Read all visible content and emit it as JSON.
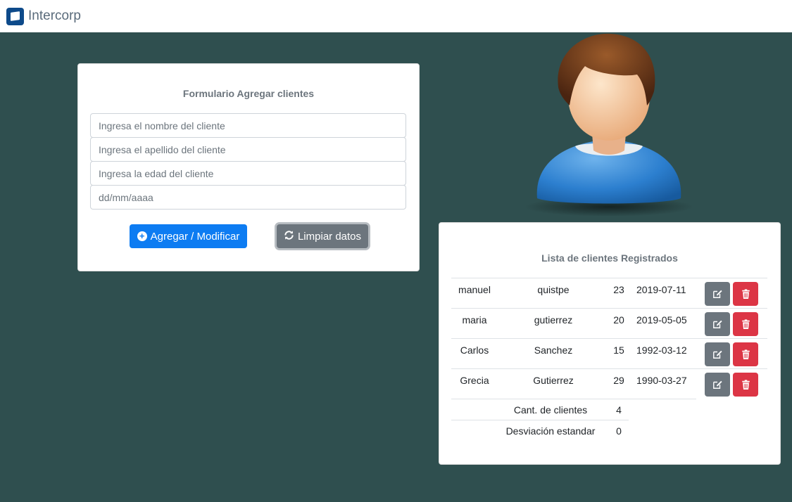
{
  "navbar": {
    "brand": "Intercorp"
  },
  "form": {
    "title": "Formulario Agregar clientes",
    "name_placeholder": "Ingresa el nombre del cliente",
    "lastname_placeholder": "Ingresa el apellido del cliente",
    "age_placeholder": "Ingresa la edad del cliente",
    "date_placeholder": "dd/mm/aaaa",
    "add_label": "Agregar / Modificar",
    "clear_label": "Limpiar datos",
    "add_icon": "plus-circle-icon",
    "clear_icon": "refresh-icon"
  },
  "list": {
    "title": "Lista de clientes Registrados",
    "rows": [
      {
        "name": "manuel",
        "lastname": "quistpe",
        "age": "23",
        "date": "2019-07-11"
      },
      {
        "name": "maria",
        "lastname": "gutierrez",
        "age": "20",
        "date": "2019-05-05"
      },
      {
        "name": "Carlos",
        "lastname": "Sanchez",
        "age": "15",
        "date": "1992-03-12"
      },
      {
        "name": "Grecia",
        "lastname": "Gutierrez",
        "age": "29",
        "date": "1990-03-27"
      }
    ],
    "count_label": "Cant. de clientes",
    "count_value": "4",
    "stddev_label": "Desviación estandar",
    "stddev_value": "0"
  },
  "colors": {
    "background": "#2f4f4f",
    "primary": "#0d7cf2",
    "secondary": "#6c757d",
    "danger": "#dc3545"
  }
}
